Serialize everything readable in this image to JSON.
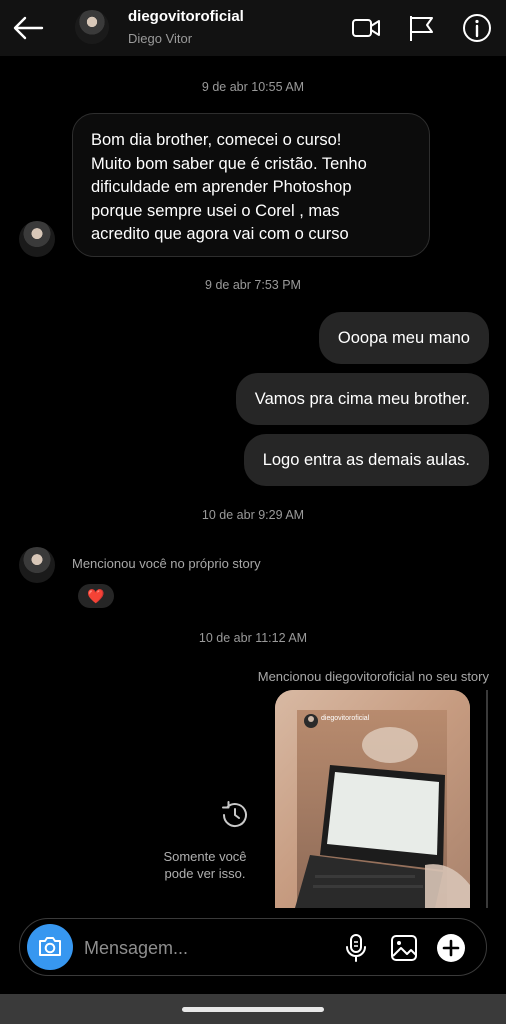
{
  "header": {
    "username": "diegovitoroficial",
    "full_name": "Diego Vitor",
    "icons": [
      "back-arrow-icon",
      "video-call-icon",
      "flag-icon",
      "info-icon"
    ]
  },
  "timestamps": {
    "t1": "9 de abr 10:55 AM",
    "t2": "9 de abr 7:53 PM",
    "t3": "10 de abr 9:29 AM",
    "t4": "10 de abr 11:12 AM"
  },
  "messages": {
    "incoming_1": {
      "lines": [
        "Bom dia brother, comecei o curso!",
        "Muito bom saber que é cristão. Tenho",
        "dificuldade em aprender Photoshop",
        "porque sempre usei o Corel , mas",
        "acredito que agora vai com o curso"
      ]
    },
    "outgoing": [
      "Ooopa meu mano",
      "Vamos pra cima meu brother.",
      "Logo entra as demais aulas."
    ],
    "mention_incoming": "Mencionou você no próprio story",
    "reaction": "❤️",
    "mention_outgoing": "Mencionou diegovitoroficial no seu story",
    "story_owner": "diegovitoroficial",
    "private_notice": {
      "line1": "Somente você",
      "line2": "pode ver isso."
    }
  },
  "composer": {
    "placeholder": "Mensagem...",
    "icons": [
      "camera-icon",
      "microphone-icon",
      "gallery-icon",
      "add-icon"
    ]
  },
  "colors": {
    "background": "#000000",
    "header_bg": "#121212",
    "outgoing_bubble": "#262626",
    "camera_button": "#3797f0",
    "timestamp_text": "#9a9a9a"
  }
}
